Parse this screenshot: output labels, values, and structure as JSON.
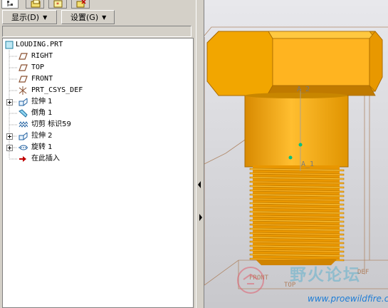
{
  "menu": {
    "display_label": "显示(D)",
    "settings_label": "设置(G)"
  },
  "tree": {
    "root": "LOUDING.PRT",
    "items": [
      {
        "label": "RIGHT",
        "icon": "datum-plane-icon"
      },
      {
        "label": "TOP",
        "icon": "datum-plane-icon"
      },
      {
        "label": "FRONT",
        "icon": "datum-plane-icon"
      },
      {
        "label": "PRT_CSYS_DEF",
        "icon": "csys-icon"
      },
      {
        "label": "拉伸 1",
        "icon": "extrude-icon",
        "expandable": true
      },
      {
        "label": "倒角 1",
        "icon": "chamfer-icon"
      },
      {
        "label": "切剪 标识59",
        "icon": "thread-cut-icon"
      },
      {
        "label": "拉伸 2",
        "icon": "extrude-icon",
        "expandable": true
      },
      {
        "label": "旋转 1",
        "icon": "revolve-icon",
        "expandable": true
      },
      {
        "label": "在此插入",
        "icon": "insert-here-arrow-icon"
      }
    ]
  },
  "viewport": {
    "axis_labels": {
      "a2": "A_2",
      "a1": "A_1",
      "front": "FRONT",
      "top": "TOP",
      "def": "DEF"
    },
    "watermark": {
      "brand": "野火论坛",
      "url": "www.proewildfire.cn"
    }
  },
  "colors": {
    "bolt": "#f2a000",
    "bolt_shadow": "#b87500",
    "background": "#d4d0c8",
    "datum": "#b08060",
    "axis_point": "#00c080"
  }
}
